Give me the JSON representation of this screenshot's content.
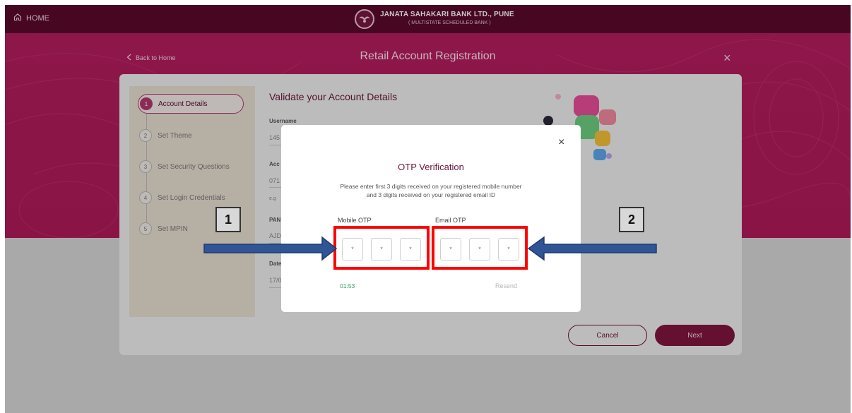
{
  "topbar": {
    "home_label": "HOME",
    "bank_name": "JANATA SAHAKARI BANK LTD., PUNE",
    "bank_sub": "( MULTISTATE SCHEDULED BANK )"
  },
  "page": {
    "back_label": "Back to Home",
    "title": "Retail Account Registration",
    "close_glyph": "×"
  },
  "steps": [
    {
      "num": "1",
      "label": "Account Details",
      "active": true
    },
    {
      "num": "2",
      "label": "Set Theme"
    },
    {
      "num": "3",
      "label": "Set Security Questions"
    },
    {
      "num": "4",
      "label": "Set Login Credentials"
    },
    {
      "num": "5",
      "label": "Set MPIN"
    }
  ],
  "form": {
    "title": "Validate your Account Details",
    "fields": [
      {
        "label": "Username",
        "value": "145"
      },
      {
        "label": "Acc",
        "value": "071"
      },
      {
        "label": "",
        "value": "e.g"
      },
      {
        "label": "PAN",
        "value": "AJD"
      },
      {
        "label": "Date",
        "value": "17/0"
      }
    ]
  },
  "buttons": {
    "cancel": "Cancel",
    "next": "Next"
  },
  "modal": {
    "close_glyph": "×",
    "title": "OTP Verification",
    "description": "Please enter first 3 digits received on your registered mobile number and 3 digits received on your registered email ID",
    "mobile_label": "Mobile OTP",
    "email_label": "Email OTP",
    "otp_placeholder": "*",
    "timer": "01:53",
    "resend": "Resend"
  },
  "annotations": {
    "label_1": "1",
    "label_2": "2",
    "highlight_color": "#ff0000",
    "arrow_color": "#2f5597"
  },
  "colors": {
    "brand_dark": "#5b0a2c",
    "brand": "#b61e5f",
    "accent": "#82153f"
  }
}
